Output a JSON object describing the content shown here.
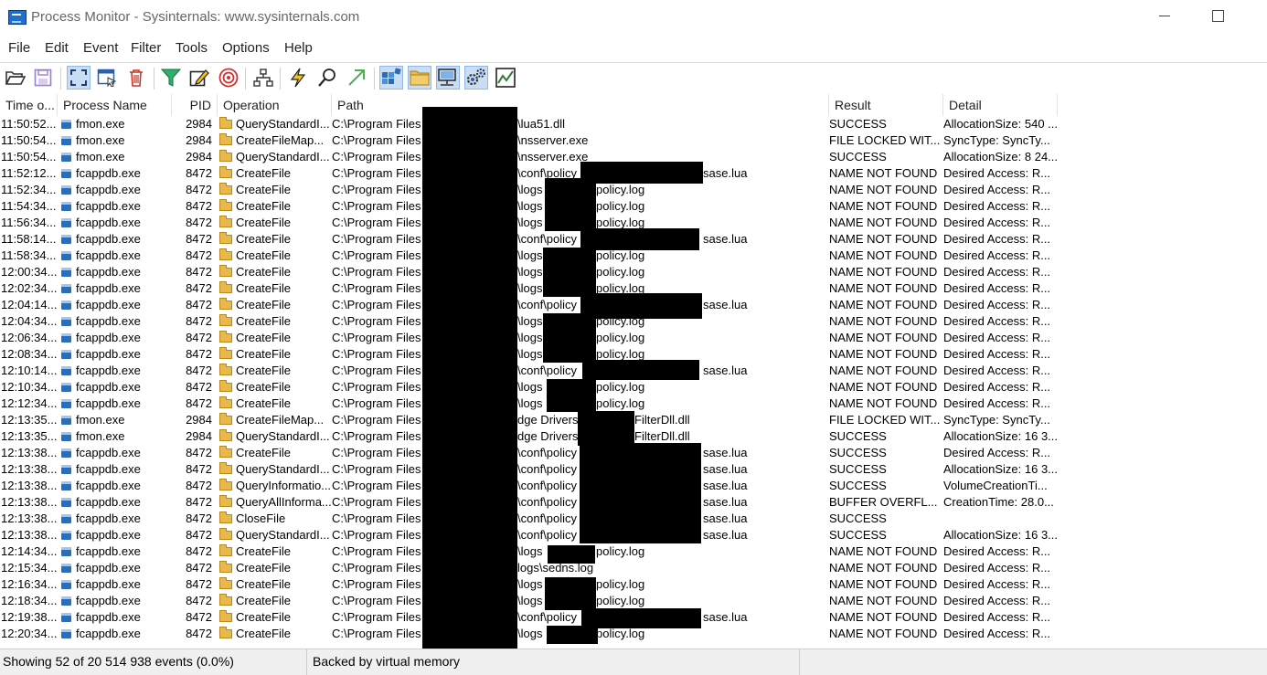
{
  "window": {
    "title": "Process Monitor - Sysinternals: www.sysinternals.com"
  },
  "menu": [
    "File",
    "Edit",
    "Event",
    "Filter",
    "Tools",
    "Options",
    "Help"
  ],
  "toolbar": [
    {
      "name": "open-icon",
      "color": "#4a4a4a"
    },
    {
      "name": "save-icon",
      "color": "#9a7fd0"
    },
    {
      "name": "capture-icon",
      "color": "#1f4f8a"
    },
    {
      "name": "autoscroll-icon",
      "color": "#2b5fa8"
    },
    {
      "name": "clear-icon",
      "color": "#c0392b"
    },
    {
      "name": "filter-icon",
      "color": "#1f9e5a"
    },
    {
      "name": "highlight-icon",
      "color": "#222222"
    },
    {
      "name": "target-icon",
      "color": "#d03030"
    },
    {
      "name": "process-tree-icon",
      "color": "#333333"
    },
    {
      "name": "jump-icon",
      "color": "#333333"
    },
    {
      "name": "find-icon",
      "color": "#333333"
    },
    {
      "name": "jump-to-icon",
      "color": "#4caf50"
    },
    {
      "name": "registry-activity-icon",
      "color": "#2b6cb0"
    },
    {
      "name": "file-activity-icon",
      "color": "#e0a830"
    },
    {
      "name": "network-activity-icon",
      "color": "#333333"
    },
    {
      "name": "process-activity-icon",
      "color": "#2b5fa8"
    },
    {
      "name": "profiling-icon",
      "color": "#2e7d32"
    }
  ],
  "columns": [
    "Time o...",
    "Process Name",
    "PID",
    "Operation",
    "Path",
    "Result",
    "Detail"
  ],
  "rows": [
    {
      "time": "11:50:52...",
      "proc": "fmon.exe",
      "pid": "2984",
      "op": "QueryStandardI...",
      "path_a": "C:\\Program Files",
      "path_b": "\\lua51.dll",
      "path_c": "",
      "result": "SUCCESS",
      "detail": "AllocationSize: 540 ..."
    },
    {
      "time": "11:50:54...",
      "proc": "fmon.exe",
      "pid": "2984",
      "op": "CreateFileMap...",
      "path_a": "C:\\Program Files",
      "path_b": "\\nsserver.exe",
      "path_c": "",
      "result": "FILE LOCKED WIT...",
      "detail": "SyncType: SyncTy..."
    },
    {
      "time": "11:50:54...",
      "proc": "fmon.exe",
      "pid": "2984",
      "op": "QueryStandardI...",
      "path_a": "C:\\Program Files",
      "path_b": "\\nsserver.exe",
      "path_c": "",
      "result": "SUCCESS",
      "detail": "AllocationSize: 8 24..."
    },
    {
      "time": "11:52:12...",
      "proc": "fcappdb.exe",
      "pid": "8472",
      "op": "CreateFile",
      "path_a": "C:\\Program Files",
      "path_b": "\\conf\\policy",
      "path_c": "sase.lua",
      "result": "NAME NOT FOUND",
      "detail": "Desired Access: R..."
    },
    {
      "time": "11:52:34...",
      "proc": "fcappdb.exe",
      "pid": "8472",
      "op": "CreateFile",
      "path_a": "C:\\Program Files",
      "path_b": "\\logs",
      "path_c": "policy.log",
      "result": "NAME NOT FOUND",
      "detail": "Desired Access: R..."
    },
    {
      "time": "11:54:34...",
      "proc": "fcappdb.exe",
      "pid": "8472",
      "op": "CreateFile",
      "path_a": "C:\\Program Files",
      "path_b": "\\logs",
      "path_c": "policy.log",
      "result": "NAME NOT FOUND",
      "detail": "Desired Access: R..."
    },
    {
      "time": "11:56:34...",
      "proc": "fcappdb.exe",
      "pid": "8472",
      "op": "CreateFile",
      "path_a": "C:\\Program Files",
      "path_b": "\\logs",
      "path_c": "policy.log",
      "result": "NAME NOT FOUND",
      "detail": "Desired Access: R..."
    },
    {
      "time": "11:58:14...",
      "proc": "fcappdb.exe",
      "pid": "8472",
      "op": "CreateFile",
      "path_a": "C:\\Program Files",
      "path_b": "\\conf\\policy",
      "path_c": "sase.lua",
      "result": "NAME NOT FOUND",
      "detail": "Desired Access: R..."
    },
    {
      "time": "11:58:34...",
      "proc": "fcappdb.exe",
      "pid": "8472",
      "op": "CreateFile",
      "path_a": "C:\\Program Files",
      "path_b": "\\logs",
      "path_c": "policy.log",
      "result": "NAME NOT FOUND",
      "detail": "Desired Access: R..."
    },
    {
      "time": "12:00:34...",
      "proc": "fcappdb.exe",
      "pid": "8472",
      "op": "CreateFile",
      "path_a": "C:\\Program Files",
      "path_b": "\\logs",
      "path_c": "policy.log",
      "result": "NAME NOT FOUND",
      "detail": "Desired Access: R..."
    },
    {
      "time": "12:02:34...",
      "proc": "fcappdb.exe",
      "pid": "8472",
      "op": "CreateFile",
      "path_a": "C:\\Program Files",
      "path_b": "\\logs",
      "path_c": "policy.log",
      "result": "NAME NOT FOUND",
      "detail": "Desired Access: R..."
    },
    {
      "time": "12:04:14...",
      "proc": "fcappdb.exe",
      "pid": "8472",
      "op": "CreateFile",
      "path_a": "C:\\Program Files",
      "path_b": "\\conf\\policy",
      "path_c": "sase.lua",
      "result": "NAME NOT FOUND",
      "detail": "Desired Access: R..."
    },
    {
      "time": "12:04:34...",
      "proc": "fcappdb.exe",
      "pid": "8472",
      "op": "CreateFile",
      "path_a": "C:\\Program Files",
      "path_b": "\\logs",
      "path_c": "policy.log",
      "result": "NAME NOT FOUND",
      "detail": "Desired Access: R..."
    },
    {
      "time": "12:06:34...",
      "proc": "fcappdb.exe",
      "pid": "8472",
      "op": "CreateFile",
      "path_a": "C:\\Program Files",
      "path_b": "\\logs",
      "path_c": "policy.log",
      "result": "NAME NOT FOUND",
      "detail": "Desired Access: R..."
    },
    {
      "time": "12:08:34...",
      "proc": "fcappdb.exe",
      "pid": "8472",
      "op": "CreateFile",
      "path_a": "C:\\Program Files",
      "path_b": "\\logs",
      "path_c": "policy.log",
      "result": "NAME NOT FOUND",
      "detail": "Desired Access: R..."
    },
    {
      "time": "12:10:14...",
      "proc": "fcappdb.exe",
      "pid": "8472",
      "op": "CreateFile",
      "path_a": "C:\\Program Files",
      "path_b": "\\conf\\policy",
      "path_c": "sase.lua",
      "result": "NAME NOT FOUND",
      "detail": "Desired Access: R..."
    },
    {
      "time": "12:10:34...",
      "proc": "fcappdb.exe",
      "pid": "8472",
      "op": "CreateFile",
      "path_a": "C:\\Program Files",
      "path_b": "\\logs",
      "path_c": "policy.log",
      "result": "NAME NOT FOUND",
      "detail": "Desired Access: R..."
    },
    {
      "time": "12:12:34...",
      "proc": "fcappdb.exe",
      "pid": "8472",
      "op": "CreateFile",
      "path_a": "C:\\Program Files",
      "path_b": "\\logs",
      "path_c": "policy.log",
      "result": "NAME NOT FOUND",
      "detail": "Desired Access: R..."
    },
    {
      "time": "12:13:35...",
      "proc": "fmon.exe",
      "pid": "2984",
      "op": "CreateFileMap...",
      "path_a": "C:\\Program Files",
      "path_b": "dge Drivers",
      "path_c": "FilterDll.dll",
      "result": "FILE LOCKED WIT...",
      "detail": "SyncType: SyncTy..."
    },
    {
      "time": "12:13:35...",
      "proc": "fmon.exe",
      "pid": "2984",
      "op": "QueryStandardI...",
      "path_a": "C:\\Program Files",
      "path_b": "dge Drivers",
      "path_c": "FilterDll.dll",
      "result": "SUCCESS",
      "detail": "AllocationSize: 16 3..."
    },
    {
      "time": "12:13:38...",
      "proc": "fcappdb.exe",
      "pid": "8472",
      "op": "CreateFile",
      "path_a": "C:\\Program Files",
      "path_b": "\\conf\\policy",
      "path_c": "sase.lua",
      "result": "SUCCESS",
      "detail": "Desired Access: R..."
    },
    {
      "time": "12:13:38...",
      "proc": "fcappdb.exe",
      "pid": "8472",
      "op": "QueryStandardI...",
      "path_a": "C:\\Program Files",
      "path_b": "\\conf\\policy",
      "path_c": "sase.lua",
      "result": "SUCCESS",
      "detail": "AllocationSize: 16 3..."
    },
    {
      "time": "12:13:38...",
      "proc": "fcappdb.exe",
      "pid": "8472",
      "op": "QueryInformatio...",
      "path_a": "C:\\Program Files",
      "path_b": "\\conf\\policy",
      "path_c": "sase.lua",
      "result": "SUCCESS",
      "detail": "VolumeCreationTi..."
    },
    {
      "time": "12:13:38...",
      "proc": "fcappdb.exe",
      "pid": "8472",
      "op": "QueryAllInforma...",
      "path_a": "C:\\Program Files",
      "path_b": "\\conf\\policy",
      "path_c": "sase.lua",
      "result": "BUFFER OVERFL...",
      "detail": "CreationTime: 28.0..."
    },
    {
      "time": "12:13:38...",
      "proc": "fcappdb.exe",
      "pid": "8472",
      "op": "CloseFile",
      "path_a": "C:\\Program Files",
      "path_b": "\\conf\\policy",
      "path_c": "sase.lua",
      "result": "SUCCESS",
      "detail": ""
    },
    {
      "time": "12:13:38...",
      "proc": "fcappdb.exe",
      "pid": "8472",
      "op": "QueryStandardI...",
      "path_a": "C:\\Program Files",
      "path_b": "\\conf\\policy",
      "path_c": "sase.lua",
      "result": "SUCCESS",
      "detail": "AllocationSize: 16 3..."
    },
    {
      "time": "12:14:34...",
      "proc": "fcappdb.exe",
      "pid": "8472",
      "op": "CreateFile",
      "path_a": "C:\\Program Files",
      "path_b": "\\logs",
      "path_c": "policy.log",
      "result": "NAME NOT FOUND",
      "detail": "Desired Access: R..."
    },
    {
      "time": "12:15:34...",
      "proc": "fcappdb.exe",
      "pid": "8472",
      "op": "CreateFile",
      "path_a": "C:\\Program Files",
      "path_b": "logs\\sedns.log",
      "path_c": "",
      "result": "NAME NOT FOUND",
      "detail": "Desired Access: R..."
    },
    {
      "time": "12:16:34...",
      "proc": "fcappdb.exe",
      "pid": "8472",
      "op": "CreateFile",
      "path_a": "C:\\Program Files",
      "path_b": "\\logs",
      "path_c": "policy.log",
      "result": "NAME NOT FOUND",
      "detail": "Desired Access: R..."
    },
    {
      "time": "12:18:34...",
      "proc": "fcappdb.exe",
      "pid": "8472",
      "op": "CreateFile",
      "path_a": "C:\\Program Files",
      "path_b": "\\logs",
      "path_c": "policy.log",
      "result": "NAME NOT FOUND",
      "detail": "Desired Access: R..."
    },
    {
      "time": "12:19:38...",
      "proc": "fcappdb.exe",
      "pid": "8472",
      "op": "CreateFile",
      "path_a": "C:\\Program Files",
      "path_b": "\\conf\\policy",
      "path_c": "sase.lua",
      "result": "NAME NOT FOUND",
      "detail": "Desired Access: R..."
    },
    {
      "time": "12:20:34...",
      "proc": "fcappdb.exe",
      "pid": "8472",
      "op": "CreateFile",
      "path_a": "C:\\Program Files",
      "path_b": "\\logs",
      "path_c": "policy.log",
      "result": "NAME NOT FOUND",
      "detail": "Desired Access: R..."
    }
  ],
  "status": {
    "events": "Showing 52 of 20 514 938 events (0.0%)",
    "memory": "Backed by virtual memory"
  }
}
